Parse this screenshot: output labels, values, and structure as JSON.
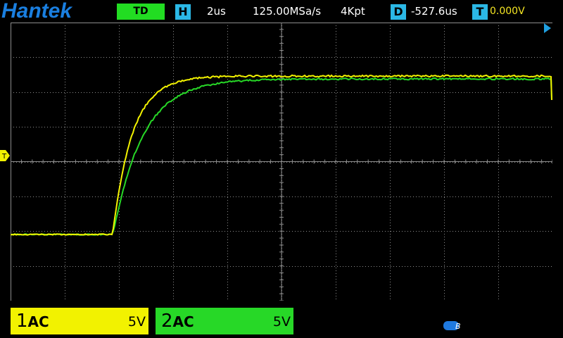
{
  "header": {
    "brand": "Hantek",
    "mode": "TD",
    "timebase_badge": "H",
    "timebase": "2us",
    "sample_rate": "125.00MSa/s",
    "memory_depth": "4Kpt",
    "delay_badge": "D",
    "delay": "-527.6us",
    "trigger_badge": "T",
    "trigger_level": "0.000V"
  },
  "trigger_marker": {
    "label": "T",
    "color": "#f2f200"
  },
  "channels": [
    {
      "number": "1",
      "coupling": "AC",
      "scale": "5V",
      "color": "#f2f200"
    },
    {
      "number": "2",
      "coupling": "AC",
      "scale": "5V",
      "color": "#27d827"
    }
  ],
  "status": {
    "icon": "bluetooth-icon",
    "glyph": "B"
  },
  "colors": {
    "brand": "#1a7fe0",
    "badge": "#2bb8e6",
    "grid": "#8c8c8c",
    "trigger_pos": "#1f9fe0"
  }
}
